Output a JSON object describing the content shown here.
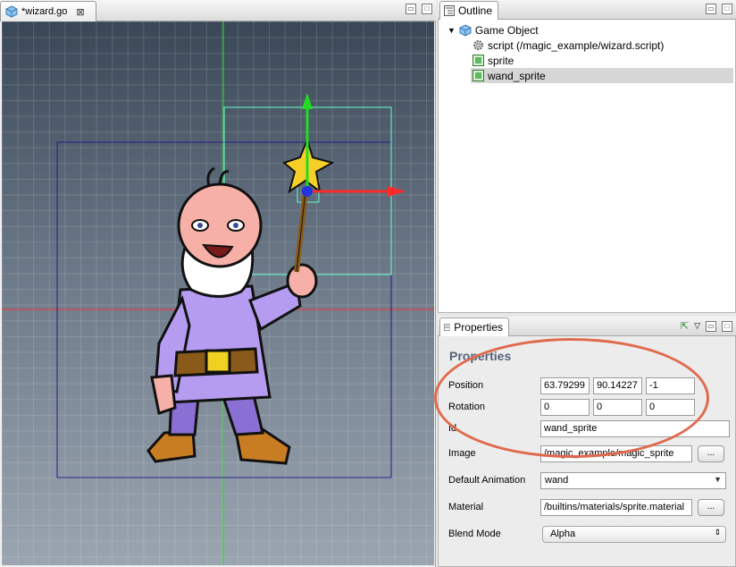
{
  "editor": {
    "tab_label": "*wizard.go",
    "tab_close": "⊠",
    "min_btn": "▭",
    "max_btn": "□"
  },
  "outline": {
    "tab_label": "Outline",
    "tab_close": "⊠",
    "min_btn": "▭",
    "max_btn": "□",
    "tree": {
      "root": "Game Object",
      "children": [
        "script (/magic_example/wizard.script)",
        "sprite",
        "wand_sprite"
      ]
    }
  },
  "properties": {
    "tab_label": "Properties",
    "heading": "Properties",
    "position_label": "Position",
    "position": [
      "63.79299",
      "90.14227",
      "-1"
    ],
    "rotation_label": "Rotation",
    "rotation": [
      "0",
      "0",
      "0"
    ],
    "id_label": "Id",
    "id_value": "wand_sprite",
    "image_label": "Image",
    "image_value": "/magic_example/magic_sprite",
    "browse_label": "...",
    "default_animation_label": "Default Animation",
    "default_animation_value": "wand",
    "material_label": "Material",
    "material_value": "/builtins/materials/sprite.material",
    "blend_mode_label": "Blend Mode",
    "blend_mode_value": "Alpha"
  },
  "colors": {
    "annotation": "#e06a4e",
    "gizmo_x": "#ff2a2a",
    "gizmo_y": "#22dd22",
    "selection": "#66ffcc",
    "bounds": "#2a1a8a"
  }
}
